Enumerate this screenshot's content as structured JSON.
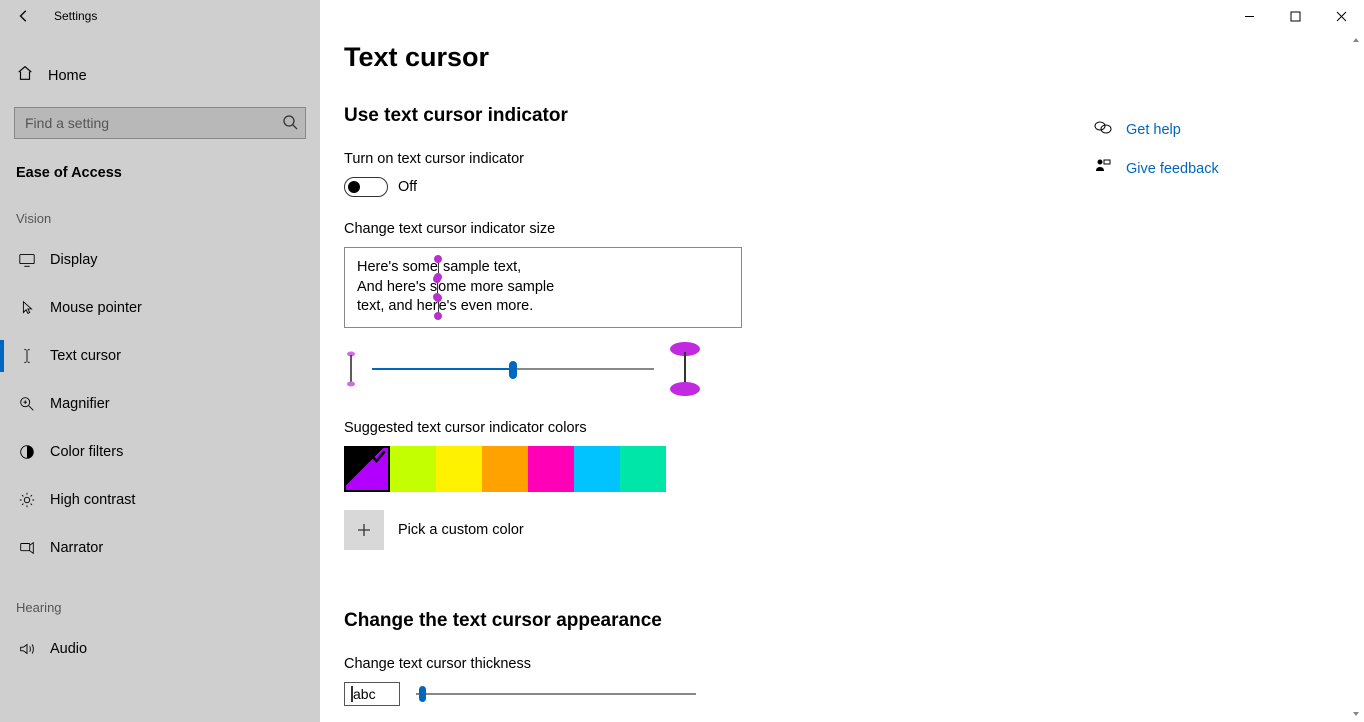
{
  "window": {
    "appTitle": "Settings"
  },
  "sidebar": {
    "home": "Home",
    "searchPlaceholder": "Find a setting",
    "category": "Ease of Access",
    "groups": {
      "vision": {
        "label": "Vision",
        "items": [
          {
            "id": "display",
            "label": "Display"
          },
          {
            "id": "mouse-pointer",
            "label": "Mouse pointer"
          },
          {
            "id": "text-cursor",
            "label": "Text cursor",
            "selected": true
          },
          {
            "id": "magnifier",
            "label": "Magnifier"
          },
          {
            "id": "color-filters",
            "label": "Color filters"
          },
          {
            "id": "high-contrast",
            "label": "High contrast"
          },
          {
            "id": "narrator",
            "label": "Narrator"
          }
        ]
      },
      "hearing": {
        "label": "Hearing",
        "items": [
          {
            "id": "audio",
            "label": "Audio"
          }
        ]
      }
    }
  },
  "page": {
    "title": "Text cursor",
    "section1": {
      "heading": "Use text cursor indicator",
      "toggleLabel": "Turn on text cursor indicator",
      "toggleState": "Off",
      "sizeLabel": "Change text cursor indicator size",
      "previewLine1a": "Here's some",
      "previewLine1b": " sample text,",
      "previewLine2a": "And here's s",
      "previewLine2b": "ome more sample",
      "previewLine3a": "text, and her",
      "previewLine3b": "e's even more.",
      "sliderValuePercent": 50,
      "colorsLabel": "Suggested text cursor indicator colors",
      "colors": [
        {
          "hex": "#b200ff",
          "selected": true
        },
        {
          "hex": "#c3ff00"
        },
        {
          "hex": "#fff200"
        },
        {
          "hex": "#ffa200"
        },
        {
          "hex": "#ff00b6"
        },
        {
          "hex": "#00c3ff"
        },
        {
          "hex": "#00e6a8"
        }
      ],
      "customColor": "Pick a custom color"
    },
    "section2": {
      "heading": "Change the text cursor appearance",
      "thicknessLabel": "Change text cursor thickness",
      "sampleText": "abc",
      "sliderValuePercent": 1
    }
  },
  "rightPane": {
    "help": "Get help",
    "feedback": "Give feedback"
  }
}
